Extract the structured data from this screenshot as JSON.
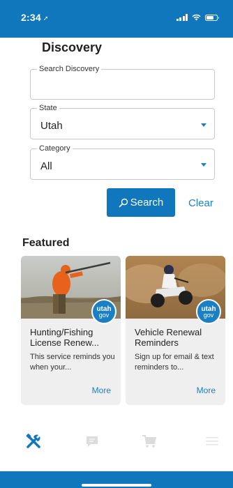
{
  "status_bar": {
    "time": "2:34",
    "location_icon": "location-arrow-icon",
    "icons": [
      "signal-icon",
      "wifi-icon",
      "battery-icon"
    ]
  },
  "header": {
    "title": "Discovery"
  },
  "search_form": {
    "search_field": {
      "label": "Search Discovery",
      "value": ""
    },
    "state_field": {
      "label": "State",
      "value": "Utah"
    },
    "category_field": {
      "label": "Category",
      "value": "All"
    },
    "search_button": {
      "label": "Search",
      "icon": "search-icon"
    },
    "clear_link": {
      "label": "Clear"
    }
  },
  "featured": {
    "heading": "Featured",
    "cards": [
      {
        "title": "Hunting/Fishing License Renew...",
        "description": "This service reminds you when your...",
        "more": "More",
        "badge_top": "utah",
        "badge_bottom": "gov",
        "image": "hunter-photo"
      },
      {
        "title": "Vehicle Renewal Reminders",
        "description": "Sign up for email & text reminders to...",
        "more": "More",
        "badge_top": "utah",
        "badge_bottom": "gov",
        "image": "atv-rider-photo"
      }
    ]
  },
  "tab_bar": {
    "tabs": [
      {
        "icon": "tools-icon",
        "active": true
      },
      {
        "icon": "chat-icon",
        "active": false
      },
      {
        "icon": "cart-icon",
        "active": false
      },
      {
        "icon": "menu-icon",
        "active": false
      }
    ]
  },
  "colors": {
    "brand": "#1177bd",
    "link": "#1a7fc4",
    "card_bg": "#efefef",
    "inactive_icon": "#d8d8d8"
  }
}
